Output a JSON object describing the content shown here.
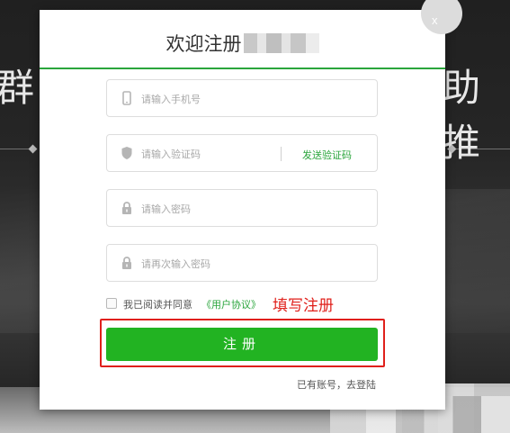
{
  "background": {
    "text_left": "群",
    "text_right": "助推"
  },
  "dialog": {
    "close_label": "x",
    "title": "欢迎注册",
    "fields": [
      {
        "placeholder": "请输入手机号",
        "icon": "phone-icon"
      },
      {
        "placeholder": "请输入验证码",
        "icon": "shield-icon",
        "action": "发送验证码"
      },
      {
        "placeholder": "请输入密码",
        "icon": "lock-icon"
      },
      {
        "placeholder": "请再次输入密码",
        "icon": "lock-icon"
      }
    ],
    "agree_text": "我已阅读并同意",
    "agree_link": "《用户协议》",
    "annotation": "填写注册",
    "register_label": "注册",
    "login_text": "已有账号，去登陆"
  },
  "colors": {
    "accent": "#2aa53c",
    "button": "#22b322",
    "annotation": "#e0201b"
  }
}
